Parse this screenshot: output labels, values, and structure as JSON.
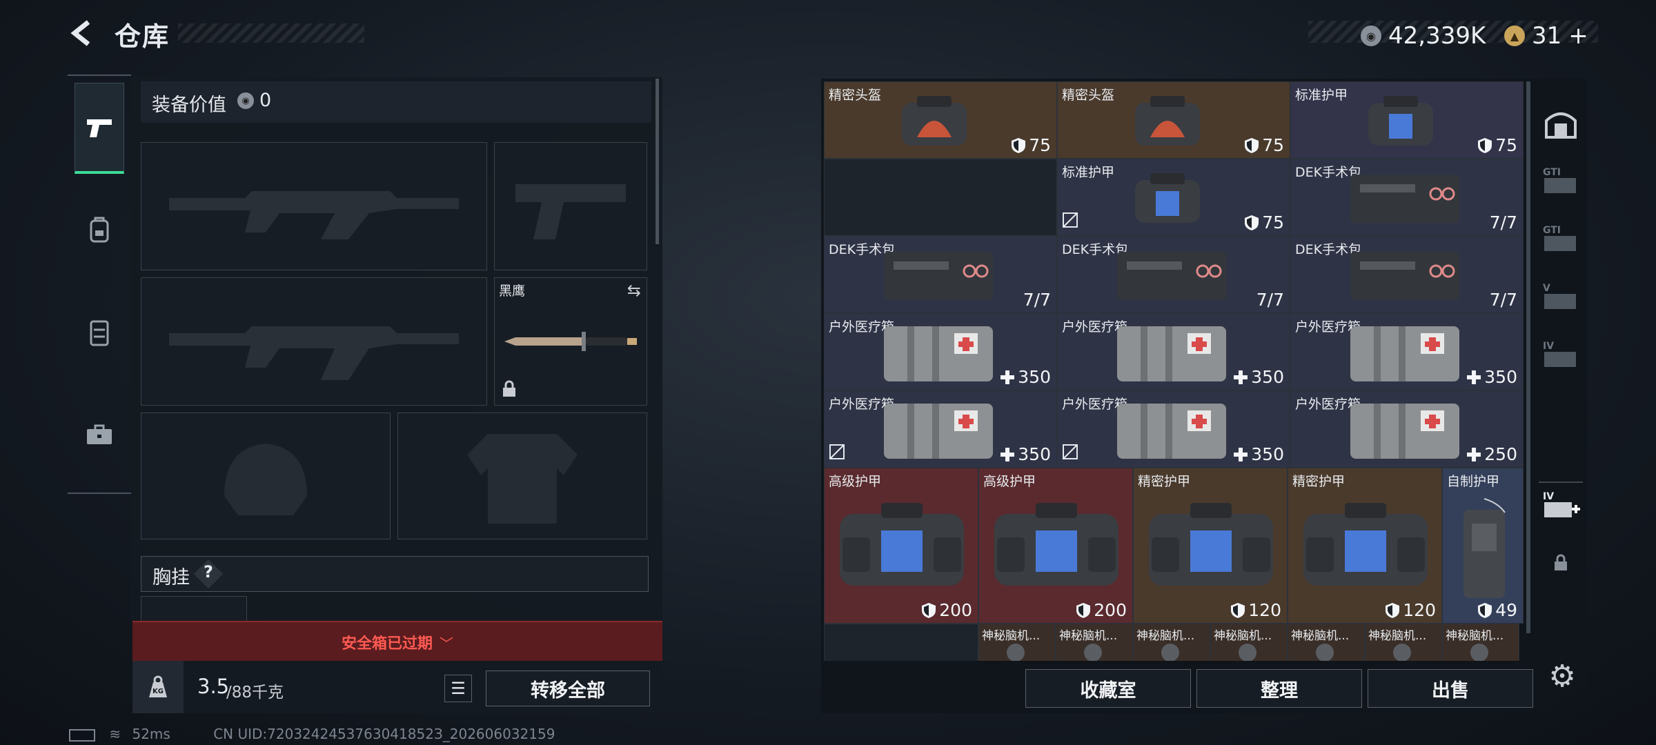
{
  "header": {
    "title": "仓库",
    "currency_main": "42,339K",
    "currency_secondary": "31"
  },
  "equipment": {
    "value_label": "装备价值",
    "value": "0",
    "melee_label": "黑鹰",
    "chest_label": "胸挂",
    "chest_help": "?"
  },
  "safebox": {
    "expired_text": "安全箱已过期"
  },
  "weight": {
    "current": "3.5",
    "max_text": "/88千克"
  },
  "buttons": {
    "transfer_all": "转移全部",
    "collection": "收藏室",
    "organize": "整理",
    "sell": "出售"
  },
  "status": {
    "ping": "52ms",
    "uid": "CN UID:7203242453763041852З_202606032159"
  },
  "inventory": {
    "row1": [
      {
        "name": "精密头盔",
        "value": "75",
        "icon": "shield-icon",
        "bg": "#4a3a2c"
      },
      {
        "name": "精密头盔",
        "value": "75",
        "icon": "shield-icon",
        "bg": "#4a3a2c"
      },
      {
        "name": "标准护甲",
        "value": "75",
        "icon": "shield-icon",
        "bg": "#33334a"
      }
    ],
    "row2": [
      {
        "name": "标准护甲",
        "value": "75",
        "icon": "shield-icon",
        "bg": "#2f3346"
      },
      {
        "name": "DEK手术包",
        "value": "7/7",
        "icon": "",
        "bg": "#2f3346"
      }
    ],
    "row3": [
      {
        "name": "DEK手术包",
        "value": "7/7",
        "icon": "",
        "bg": "#2f3346"
      },
      {
        "name": "DEK手术包",
        "value": "7/7",
        "icon": "",
        "bg": "#2f3346"
      },
      {
        "name": "DEK手术包",
        "value": "7/7",
        "icon": "",
        "bg": "#2f3346"
      }
    ],
    "row4": [
      {
        "name": "户外医疗箱",
        "value": "350",
        "icon": "plus-icon",
        "bg": "#2f3346"
      },
      {
        "name": "户外医疗箱",
        "value": "350",
        "icon": "plus-icon",
        "bg": "#2f3346"
      },
      {
        "name": "户外医疗箱",
        "value": "350",
        "icon": "plus-icon",
        "bg": "#2f3346"
      }
    ],
    "row5": [
      {
        "name": "户外医疗箱",
        "value": "350",
        "icon": "plus-icon",
        "bg": "#2f3346"
      },
      {
        "name": "户外医疗箱",
        "value": "350",
        "icon": "plus-icon",
        "bg": "#2f3346"
      },
      {
        "name": "户外医疗箱",
        "value": "250",
        "icon": "plus-icon",
        "bg": "#2f3346"
      }
    ],
    "row6": [
      {
        "name": "高级护甲",
        "value": "200",
        "icon": "shield-icon",
        "bg": "#5a2a2e"
      },
      {
        "name": "高级护甲",
        "value": "200",
        "icon": "shield-icon",
        "bg": "#5a2a2e"
      },
      {
        "name": "精密护甲",
        "value": "120",
        "icon": "shield-icon",
        "bg": "#4a3a2c"
      },
      {
        "name": "精密护甲",
        "value": "120",
        "icon": "shield-icon",
        "bg": "#4a3a2c"
      },
      {
        "name": "自制护甲",
        "value": "49",
        "icon": "shield-icon",
        "bg": "#34405a"
      }
    ],
    "row7": [
      "神秘脑机...",
      "神秘脑机...",
      "神秘脑机...",
      "神秘脑机...",
      "神秘脑机...",
      "神秘脑机...",
      "神秘脑机..."
    ]
  },
  "colors": {
    "accent": "#3ddc97",
    "warning": "#e84848",
    "gold_bg": "#4a3a2c",
    "red_bg": "#5a2a2e",
    "blue_bg": "#2f3346"
  }
}
